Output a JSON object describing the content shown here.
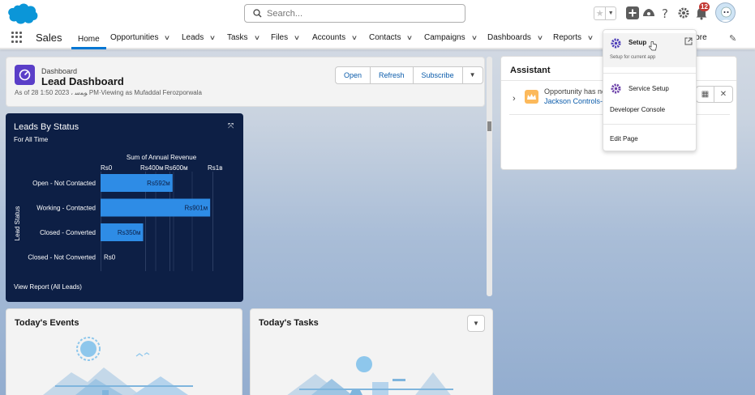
{
  "header": {
    "search_placeholder": "Search...",
    "notification_count": "12"
  },
  "nav": {
    "app_name": "Sales",
    "items": [
      {
        "label": "Home",
        "active": true
      },
      {
        "label": "Opportunities"
      },
      {
        "label": "Leads"
      },
      {
        "label": "Tasks"
      },
      {
        "label": "Files"
      },
      {
        "label": "Accounts"
      },
      {
        "label": "Contacts"
      },
      {
        "label": "Campaigns"
      },
      {
        "label": "Dashboards"
      },
      {
        "label": "Reports"
      }
    ],
    "more_label": "lore"
  },
  "dashboard": {
    "subtitle": "Dashboard",
    "title": "Lead Dashboard",
    "as_of": "As of 28 1:50 2023 ، ﻮﻤﺳ PM·Viewing as Mufaddal Ferozporwala",
    "buttons": {
      "open": "Open",
      "refresh": "Refresh",
      "subscribe": "Subscribe"
    }
  },
  "chart_card": {
    "title": "Leads By Status",
    "subtitle": "For All Time",
    "footer": "View Report (All Leads)"
  },
  "chart_data": {
    "type": "bar",
    "orientation": "horizontal",
    "title": "Sum of Annual Revenue",
    "ylabel": "Lead Status",
    "xlabel": "",
    "x_ticks": [
      "Rs0",
      "Rs400м",
      "Rs600м",
      "Rs1в"
    ],
    "categories": [
      "Open - Not Contacted",
      "Working - Contacted",
      "Closed - Converted",
      "Closed - Not Converted"
    ],
    "values": [
      592,
      901,
      350,
      0
    ],
    "value_labels": [
      "Rs592м",
      "Rs901м",
      "Rs350м",
      "Rs0"
    ],
    "unit": "Rs million",
    "xlim": [
      0,
      1000
    ],
    "bar_color": "#2e8ce6",
    "grid": true
  },
  "assistant": {
    "title": "Assistant",
    "item_text": "Opportunity has no",
    "item_link": "Jackson Controls-"
  },
  "setup_menu": {
    "setup_label": "Setup",
    "setup_sub": "Setup for current app",
    "service_setup": "Service Setup",
    "developer_console": "Developer Console",
    "edit_page": "Edit Page"
  },
  "cards": {
    "events_title": "Today's Events",
    "tasks_title": "Today's Tasks"
  },
  "colors": {
    "brand": "#0176d3",
    "chart_bg": "#0d1f45",
    "dashboard_icon": "#5a3ec8",
    "setup_gear": "#4b3cb8",
    "notification_badge": "#c23934"
  }
}
